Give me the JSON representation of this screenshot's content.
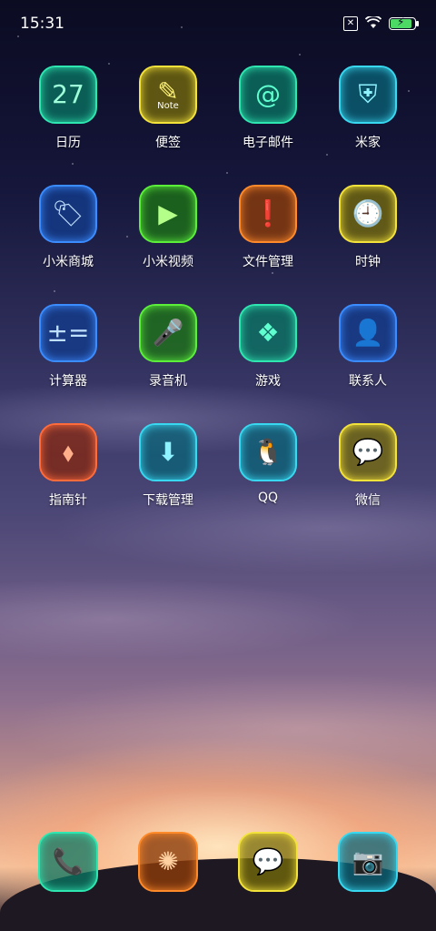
{
  "status_bar": {
    "time": "15:31"
  },
  "apps": [
    {
      "label": "日历",
      "icon": "calendar-icon",
      "glyph": "27",
      "style": "c-teal"
    },
    {
      "label": "便签",
      "icon": "dropper-note-icon",
      "glyph": "✎",
      "sub": "Note",
      "style": "c-yellow"
    },
    {
      "label": "电子邮件",
      "icon": "at-icon",
      "glyph": "@",
      "style": "c-teal"
    },
    {
      "label": "米家",
      "icon": "mijia-shield-icon",
      "glyph": "⛨",
      "style": "c-cyan"
    },
    {
      "label": "小米商城",
      "icon": "tag-icon",
      "glyph": "🏷",
      "style": "c-blue"
    },
    {
      "label": "小米视频",
      "icon": "play-icon",
      "glyph": "▶",
      "style": "c-green"
    },
    {
      "label": "文件管理",
      "icon": "file-clip-icon",
      "glyph": "❗",
      "style": "c-orange"
    },
    {
      "label": "时钟",
      "icon": "clock-icon",
      "glyph": "🕘",
      "style": "c-yellow"
    },
    {
      "label": "计算器",
      "icon": "calculator-icon",
      "glyph": "±=",
      "style": "c-blue"
    },
    {
      "label": "录音机",
      "icon": "microphone-icon",
      "glyph": "🎤",
      "style": "c-green"
    },
    {
      "label": "游戏",
      "icon": "box-icon",
      "glyph": "❖",
      "style": "c-teal"
    },
    {
      "label": "联系人",
      "icon": "person-icon",
      "glyph": "👤",
      "style": "c-blue"
    },
    {
      "label": "指南针",
      "icon": "compass-needle-icon",
      "glyph": "⬧",
      "style": "c-red"
    },
    {
      "label": "下载管理",
      "icon": "download-icon",
      "glyph": "⬇",
      "style": "c-cyan"
    },
    {
      "label": "QQ",
      "icon": "qq-penguin-icon",
      "glyph": "🐧",
      "style": "c-cyan"
    },
    {
      "label": "微信",
      "icon": "wechat-icon",
      "glyph": "💬",
      "style": "c-yellow"
    }
  ],
  "dock": [
    {
      "name": "phone",
      "icon": "phone-icon",
      "glyph": "📞",
      "style": "c-teal"
    },
    {
      "name": "browser",
      "icon": "compass-browser-icon",
      "glyph": "✺",
      "style": "c-orange"
    },
    {
      "name": "messages",
      "icon": "message-icon",
      "glyph": "💬",
      "style": "c-yellow"
    },
    {
      "name": "camera",
      "icon": "camera-icon",
      "glyph": "📷",
      "style": "c-cyan"
    }
  ]
}
